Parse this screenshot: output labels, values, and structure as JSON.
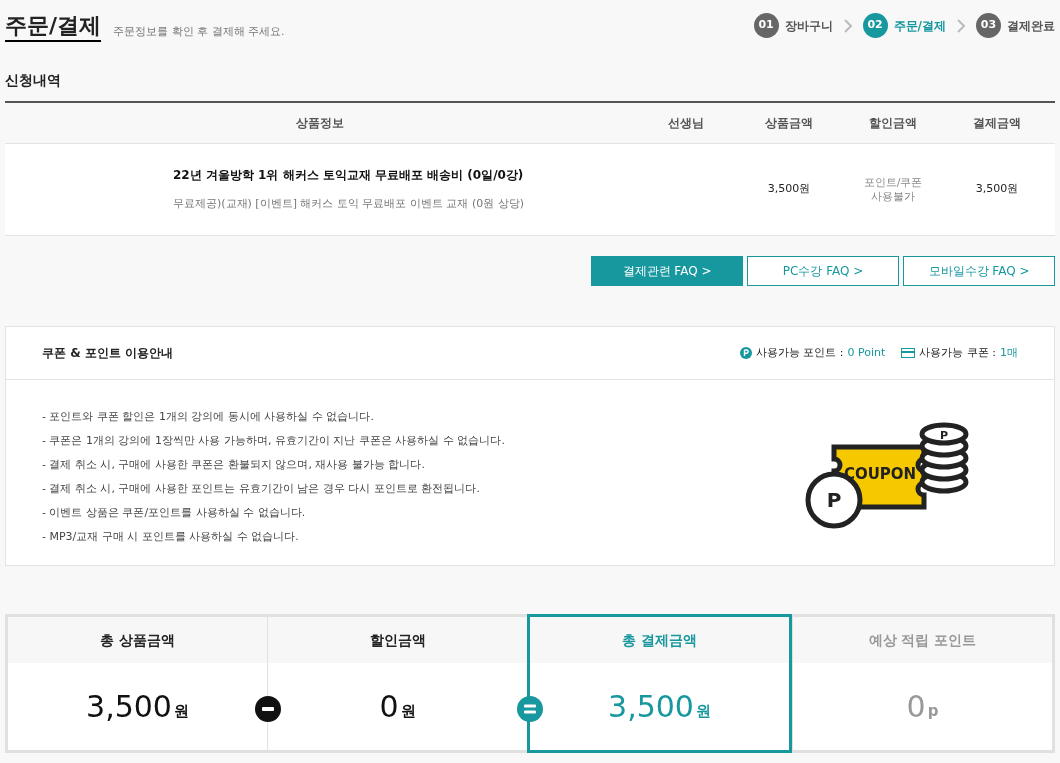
{
  "page_title": "주문/결제",
  "page_subtitle": "주문정보를 확인 후 결제해 주세요.",
  "steps": [
    {
      "number": "01",
      "label": "장바구니",
      "selected": false
    },
    {
      "number": "02",
      "label": "주문/결제",
      "selected": true
    },
    {
      "number": "03",
      "label": "결제완료",
      "selected": false
    }
  ],
  "section_title": "신청내역",
  "table": {
    "columns": [
      "상품정보",
      "선생님",
      "상품금액",
      "할인금액",
      "결제금액"
    ],
    "rows": [
      {
        "title": "22년 겨울방학 1위 해커스 토익교재 무료배포 배송비 (0일/0강)",
        "detail": "무료제공)(교재) [이벤트] 해커스 토익 무료배포 이벤트 교재 (0원 상당)",
        "teacher": "",
        "price": "3,500원",
        "discount": "포인트/쿠폰\n사용불가",
        "payment": "3,500원"
      }
    ]
  },
  "faq_buttons": [
    {
      "label": "결제관련 FAQ >",
      "selected": true
    },
    {
      "label": "PC수강 FAQ >",
      "selected": false
    },
    {
      "label": "모바일수강 FAQ >",
      "selected": false
    }
  ],
  "coupon_info": {
    "title": "쿠폰 & 포인트 이용안내",
    "points_label": "사용가능 포인트 :",
    "points_value": "0 Point",
    "coupons_label": "사용가능 쿠폰 :",
    "coupons_value": "1매",
    "notes": [
      "- 포인트와 쿠폰 할인은 1개의 강의에 동시에 사용하실 수 없습니다.",
      "- 쿠폰은 1개의 강의에 1장씩만 사용 가능하며, 유효기간이 지난 쿠폰은 사용하실 수 없습니다.",
      "- 결제 취소 시, 구매에 사용한 쿠폰은 환불되지 않으며, 재사용 불가능 합니다.",
      "- 결제 취소 시, 구매에 사용한 포인트는 유효기간이 남은 경우 다시 포인트로 환전됩니다.",
      "- 이벤트 상품은 쿠폰/포인트를 사용하실 수 없습니다.",
      "- MP3/교재 구매 시 포인트를 사용하실 수 없습니다."
    ],
    "illustration_text": "COUPON",
    "illustration_coin_front": "P",
    "illustration_coin_stack": "P"
  },
  "summary": [
    {
      "label": "총 상품금액",
      "amount": "3,500",
      "unit": "원",
      "kind": "start",
      "muted": false,
      "selected": false
    },
    {
      "label": "할인금액",
      "amount": "0",
      "unit": "원",
      "kind": "minus",
      "muted": false,
      "selected": false
    },
    {
      "label": "총 결제금액",
      "amount": "3,500",
      "unit": "원",
      "kind": "equals",
      "muted": false,
      "selected": true
    },
    {
      "label": "예상 적립 포인트",
      "amount": "0",
      "unit": "p",
      "kind": "start",
      "muted": true,
      "selected": false
    }
  ]
}
